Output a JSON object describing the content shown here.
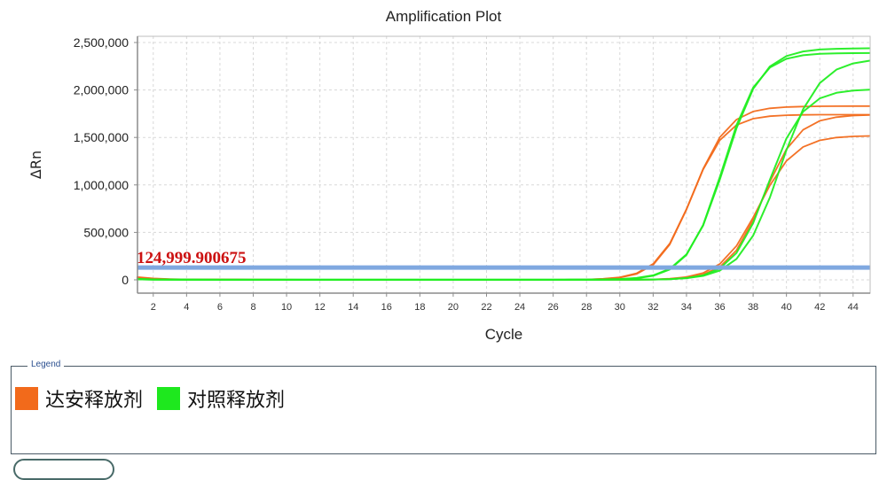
{
  "chart_data": {
    "type": "line",
    "title": "Amplification Plot",
    "xlabel": "Cycle",
    "ylabel": "ΔRn",
    "xlim": [
      1,
      45
    ],
    "ylim": [
      -120000,
      2560000
    ],
    "x_ticks": [
      2,
      4,
      6,
      8,
      10,
      12,
      14,
      16,
      18,
      20,
      22,
      24,
      26,
      28,
      30,
      32,
      34,
      36,
      38,
      40,
      42,
      44
    ],
    "x_tick_labels": [
      "2",
      "4",
      "6",
      "8",
      "10",
      "12",
      "14",
      "16",
      "18",
      "20",
      "22",
      "24",
      "26",
      "28",
      "30",
      "32",
      "34",
      "36",
      "38",
      "40",
      "42",
      "44"
    ],
    "y_ticks": [
      0,
      500000,
      1000000,
      1500000,
      2000000,
      2500000
    ],
    "y_tick_labels": [
      "0",
      "500,000",
      "1,000,000",
      "1,500,000",
      "2,000,000",
      "2,500,000"
    ],
    "grid": true,
    "threshold": {
      "value": 124999.900675,
      "label": "124,999.900675",
      "color": "#7fa8e0",
      "label_color": "#cc1111"
    },
    "x": [
      1,
      2,
      3,
      4,
      5,
      6,
      7,
      8,
      9,
      10,
      11,
      12,
      13,
      14,
      15,
      16,
      17,
      18,
      19,
      20,
      21,
      22,
      23,
      24,
      25,
      26,
      27,
      28,
      29,
      30,
      31,
      32,
      33,
      34,
      35,
      36,
      37,
      38,
      39,
      40,
      41,
      42,
      43,
      44,
      45
    ],
    "series": [
      {
        "name": "达安释放剂",
        "group": "orange",
        "color": "#f26a1b",
        "values": [
          30000,
          15000,
          8000,
          5000,
          4000,
          3000,
          3000,
          2000,
          2000,
          2000,
          1000,
          1000,
          1000,
          1000,
          1000,
          1000,
          1000,
          1000,
          1000,
          1000,
          1000,
          1000,
          1000,
          1000,
          1000,
          1000,
          2000,
          4000,
          11000,
          27000,
          69000,
          169000,
          382000,
          744000,
          1169000,
          1502000,
          1688000,
          1773000,
          1807000,
          1820000,
          1826000,
          1828000,
          1829000,
          1830000,
          1830000
        ]
      },
      {
        "name": "达安释放剂",
        "group": "orange",
        "color": "#f26a1b",
        "values": [
          25000,
          12000,
          6000,
          4000,
          3000,
          3000,
          2000,
          2000,
          2000,
          1000,
          1000,
          1000,
          1000,
          1000,
          1000,
          1000,
          1000,
          1000,
          1000,
          1000,
          1000,
          1000,
          1000,
          1000,
          1000,
          1000,
          1000,
          3000,
          9000,
          23000,
          62000,
          159000,
          373000,
          740000,
          1162000,
          1471000,
          1631000,
          1698000,
          1724000,
          1734000,
          1738000,
          1740000,
          1740000,
          1740000,
          1740000
        ]
      },
      {
        "name": "达安释放剂",
        "group": "orange",
        "color": "#f26a1b",
        "values": [
          20000,
          10000,
          5000,
          3000,
          2000,
          2000,
          2000,
          1000,
          1000,
          1000,
          1000,
          1000,
          1000,
          1000,
          1000,
          1000,
          1000,
          1000,
          1000,
          1000,
          1000,
          1000,
          1000,
          1000,
          1000,
          1000,
          1000,
          1000,
          1000,
          1000,
          2000,
          3000,
          8000,
          21000,
          55000,
          135000,
          312000,
          628000,
          1033000,
          1376000,
          1580000,
          1675000,
          1714000,
          1730000,
          1736000
        ]
      },
      {
        "name": "达安释放剂",
        "group": "orange",
        "color": "#f26a1b",
        "values": [
          18000,
          9000,
          5000,
          3000,
          2000,
          2000,
          2000,
          1000,
          1000,
          1000,
          1000,
          1000,
          1000,
          1000,
          1000,
          1000,
          1000,
          1000,
          1000,
          1000,
          1000,
          1000,
          1000,
          1000,
          1000,
          1000,
          1000,
          1000,
          1000,
          2000,
          3000,
          5000,
          12000,
          30000,
          72000,
          167000,
          357000,
          657000,
          994000,
          1253000,
          1400000,
          1469000,
          1499000,
          1511000,
          1516000
        ]
      },
      {
        "name": "对照释放剂",
        "group": "green",
        "color": "#22ee22",
        "values": [
          10000,
          5000,
          3000,
          2000,
          2000,
          1000,
          1000,
          1000,
          1000,
          1000,
          1000,
          1000,
          1000,
          1000,
          1000,
          1000,
          1000,
          1000,
          1000,
          1000,
          1000,
          1000,
          1000,
          1000,
          1000,
          1000,
          2000,
          3000,
          5000,
          8000,
          20000,
          48000,
          116000,
          268000,
          573000,
          1056000,
          1596000,
          2012000,
          2247000,
          2357000,
          2406000,
          2426000,
          2434000,
          2437000,
          2439000
        ]
      },
      {
        "name": "对照释放剂",
        "group": "green",
        "color": "#22ee22",
        "values": [
          8000,
          4000,
          2000,
          2000,
          1000,
          1000,
          1000,
          1000,
          1000,
          1000,
          1000,
          1000,
          1000,
          1000,
          1000,
          1000,
          1000,
          1000,
          1000,
          1000,
          1000,
          1000,
          1000,
          1000,
          1000,
          1000,
          2000,
          2000,
          4000,
          7000,
          17000,
          43000,
          109000,
          262000,
          577000,
          1082000,
          1629000,
          2025000,
          2236000,
          2328000,
          2366000,
          2381000,
          2386000,
          2388000,
          2389000
        ]
      },
      {
        "name": "对照释放剂",
        "group": "green",
        "color": "#22ee22",
        "values": [
          6000,
          3000,
          2000,
          1000,
          1000,
          1000,
          1000,
          1000,
          1000,
          1000,
          1000,
          1000,
          1000,
          1000,
          1000,
          1000,
          1000,
          1000,
          1000,
          1000,
          1000,
          1000,
          1000,
          1000,
          1000,
          1000,
          1000,
          1000,
          1000,
          2000,
          2000,
          4000,
          7000,
          18000,
          42000,
          98000,
          220000,
          466000,
          866000,
          1367000,
          1798000,
          2073000,
          2215000,
          2280000,
          2309000
        ]
      },
      {
        "name": "对照释放剂",
        "group": "green",
        "color": "#22ee22",
        "values": [
          6000,
          3000,
          2000,
          1000,
          1000,
          1000,
          1000,
          1000,
          1000,
          1000,
          1000,
          1000,
          1000,
          1000,
          1000,
          1000,
          1000,
          1000,
          1000,
          1000,
          1000,
          1000,
          1000,
          1000,
          1000,
          1000,
          1000,
          1000,
          1000,
          2000,
          2000,
          4000,
          7000,
          19000,
          48000,
          120000,
          283000,
          598000,
          1053000,
          1489000,
          1771000,
          1911000,
          1970000,
          1994000,
          2003000
        ]
      }
    ]
  },
  "legend": {
    "title": "Legend",
    "items": [
      {
        "label": "达安释放剂",
        "color": "#f26a1b"
      },
      {
        "label": "对照释放剂",
        "color": "#1ee81e"
      }
    ]
  },
  "colors": {
    "axis": "#8c8c8c",
    "grid": "#d8d8d8",
    "text": "#222222"
  }
}
